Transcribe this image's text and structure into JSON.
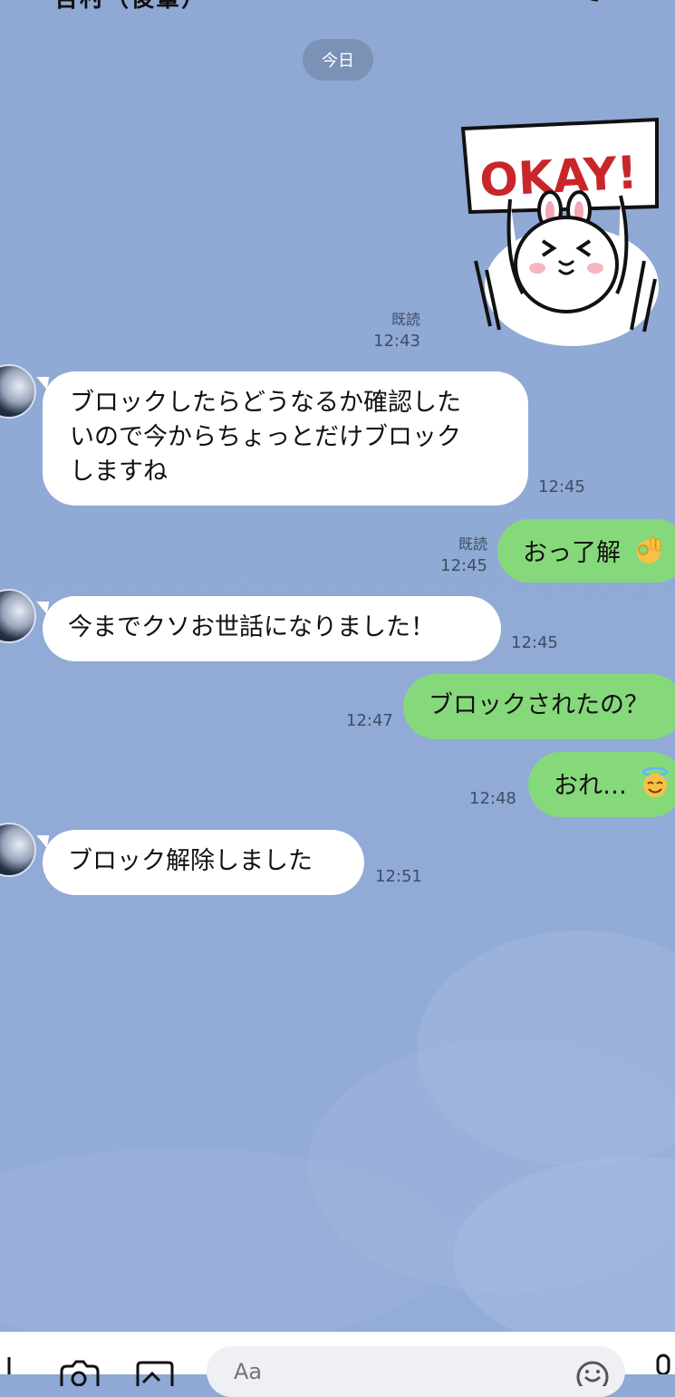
{
  "header": {
    "title": "吉村（後輩）",
    "back_icon": "chevron-left-icon",
    "search_icon": "search-icon",
    "call_icon": "phone-icon",
    "menu_icon": "menu-icon"
  },
  "date_label": "今日",
  "sticker": {
    "text": "OKAY!",
    "read": "既読",
    "time": "12:43"
  },
  "messages": [
    {
      "side": "left",
      "text_lines": [
        "ブロックしたらどうなるか確認した",
        "いので今からちょっとだけブロック",
        "しますね"
      ],
      "time": "12:45"
    },
    {
      "side": "right",
      "text": "おっ了解",
      "emoji": "ok-hand-emoji",
      "read": "既読",
      "time": "12:45"
    },
    {
      "side": "left",
      "text": "今までクソお世話になりました！",
      "time": "12:45"
    },
    {
      "side": "right",
      "text": "ブロックされたの？",
      "time": "12:47"
    },
    {
      "side": "right",
      "text": "おれ…",
      "emoji": "halo-face-emoji",
      "time": "12:48"
    },
    {
      "side": "left",
      "text": "ブロック解除しました",
      "time": "12:51"
    }
  ],
  "input": {
    "placeholder": "Aa"
  },
  "colors": {
    "background": "#91aad6",
    "my_bubble": "#86d97b",
    "their_bubble": "#ffffff",
    "date_pill": "#7b91b6"
  }
}
